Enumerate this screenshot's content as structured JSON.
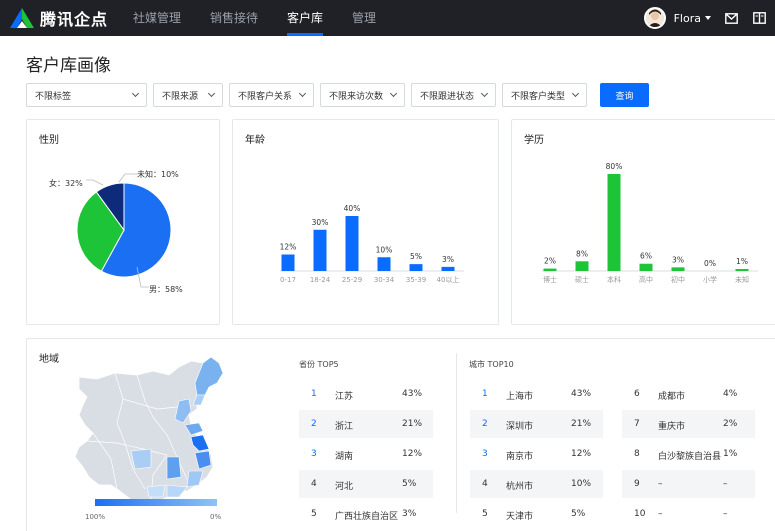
{
  "app": {
    "name": "腾讯企点"
  },
  "nav": [
    {
      "label": "社媒管理",
      "active": false
    },
    {
      "label": "销售接待",
      "active": false
    },
    {
      "label": "客户库",
      "active": true
    },
    {
      "label": "管理",
      "active": false
    }
  ],
  "user": {
    "name": "Flora"
  },
  "page": {
    "title": "客户库画像"
  },
  "filters": {
    "tag": "不限标签",
    "source": "不限来源",
    "relation": "不限客户关系",
    "visits": "不限来访次数",
    "followup": "不限跟进状态",
    "type": "不限客户类型",
    "query_label": "查询"
  },
  "gender": {
    "title": "性别",
    "labels": {
      "female": "女：32%",
      "unknown": "未知：10%",
      "male": "男：58%"
    },
    "chart_data": {
      "type": "pie",
      "slices": [
        {
          "label": "男",
          "value": 58,
          "color": "#1a6ff2"
        },
        {
          "label": "女",
          "value": 32,
          "color": "#1dc437"
        },
        {
          "label": "未知",
          "value": 10,
          "color": "#0e2a7a"
        }
      ]
    }
  },
  "age": {
    "title": "年龄",
    "chart_data": {
      "type": "bar",
      "categories": [
        "0-17",
        "18-24",
        "25-29",
        "30-34",
        "35-39",
        "40以上"
      ],
      "values": [
        12,
        30,
        40,
        10,
        5,
        3
      ],
      "labels": [
        "12%",
        "30%",
        "40%",
        "10%",
        "5%",
        "3%"
      ],
      "color": "#0a6cff"
    }
  },
  "education": {
    "title": "学历",
    "chart_data": {
      "type": "bar",
      "categories": [
        "博士",
        "硕士",
        "本科",
        "高中",
        "初中",
        "小学",
        "未知"
      ],
      "values": [
        2,
        8,
        80,
        6,
        3,
        0,
        1
      ],
      "labels": [
        "2%",
        "8%",
        "80%",
        "6%",
        "3%",
        "0%",
        "1%"
      ],
      "color": "#1dc437"
    }
  },
  "region": {
    "title": "地域",
    "legend": {
      "max": "100%",
      "min": "0%"
    },
    "province_header": "省份 TOP5",
    "city_header": "城市 TOP10",
    "provinces": [
      {
        "rank": "1",
        "name": "江苏",
        "pct": "43%"
      },
      {
        "rank": "2",
        "name": "浙江",
        "pct": "21%"
      },
      {
        "rank": "3",
        "name": "湖南",
        "pct": "12%"
      },
      {
        "rank": "4",
        "name": "河北",
        "pct": "5%"
      },
      {
        "rank": "5",
        "name": "广西壮族自治区",
        "pct": "3%"
      }
    ],
    "cities_left": [
      {
        "rank": "1",
        "name": "上海市",
        "pct": "43%"
      },
      {
        "rank": "2",
        "name": "深圳市",
        "pct": "21%"
      },
      {
        "rank": "3",
        "name": "南京市",
        "pct": "12%"
      },
      {
        "rank": "4",
        "name": "杭州市",
        "pct": "10%"
      },
      {
        "rank": "5",
        "name": "天津市",
        "pct": "5%"
      }
    ],
    "cities_right": [
      {
        "rank": "6",
        "name": "成都市",
        "pct": "4%"
      },
      {
        "rank": "7",
        "name": "重庆市",
        "pct": "2%"
      },
      {
        "rank": "8",
        "name": "白沙黎族自治县",
        "pct": "1%"
      },
      {
        "rank": "9",
        "name": "–",
        "pct": "–"
      },
      {
        "rank": "10",
        "name": "–",
        "pct": "–"
      }
    ]
  },
  "colors": {
    "accent": "#0a6cff",
    "green": "#1dc437",
    "navbar": "#1f2126"
  }
}
